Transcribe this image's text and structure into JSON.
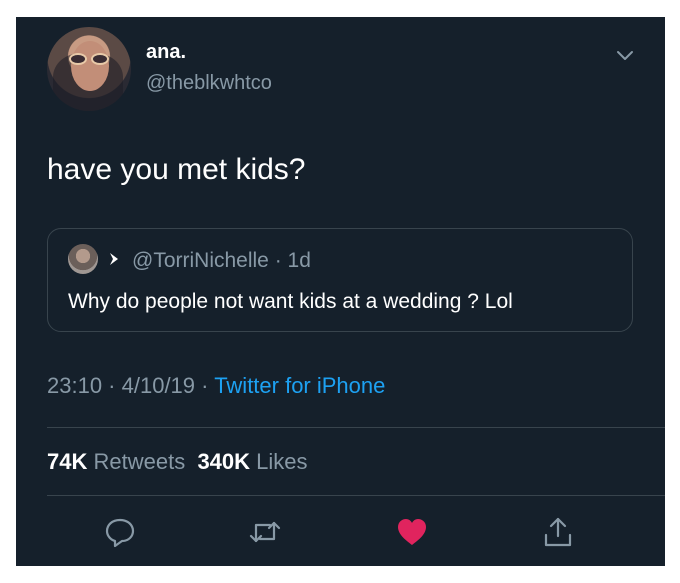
{
  "user": {
    "name": "ana.",
    "handle": "@theblkwhtco",
    "avatar_icon": "profile-photo"
  },
  "tweet": {
    "text": "have you met kids?"
  },
  "quoted": {
    "reply_icon": "reply-arrow-icon",
    "handle": "@TorriNichelle",
    "separator": " · ",
    "age": "1d",
    "text": "Why do people not want kids at a wedding ? Lol"
  },
  "meta": {
    "time": "23:10",
    "sep1": " · ",
    "date": "4/10/19",
    "sep2": " · ",
    "source": "Twitter for iPhone"
  },
  "stats": {
    "retweets_count": "74K",
    "retweets_label": "Retweets",
    "likes_count": "340K",
    "likes_label": "Likes"
  },
  "actions": {
    "reply_icon": "reply-icon",
    "retweet_icon": "retweet-icon",
    "like_icon": "heart-icon",
    "share_icon": "share-icon"
  },
  "colors": {
    "background": "#15202b",
    "text": "#ffffff",
    "muted": "#8899a6",
    "link": "#1da1f2",
    "like": "#e0245e",
    "border": "#38444d"
  }
}
